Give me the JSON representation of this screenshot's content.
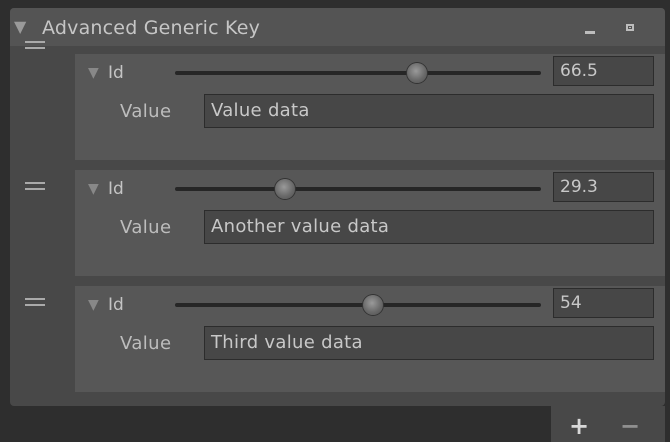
{
  "panel": {
    "title": "Advanced Generic Key",
    "collapse_icon": "triangle-down-icon",
    "minimize_icon": "minimize-icon",
    "maximize_icon": "maximize-icon"
  },
  "elements": [
    {
      "id_label": "Id",
      "id_value": "66.5",
      "slider_fraction": 0.66,
      "value_label": "Value",
      "value_text": "Value data"
    },
    {
      "id_label": "Id",
      "id_value": "29.3",
      "slider_fraction": 0.3,
      "value_label": "Value",
      "value_text": "Another value data"
    },
    {
      "id_label": "Id",
      "id_value": "54",
      "slider_fraction": 0.54,
      "value_label": "Value",
      "value_text": "Third value data"
    }
  ],
  "footer": {
    "add_label": "+",
    "remove_label": "−"
  },
  "colors": {
    "panel_bg": "#484848",
    "header_bg": "#545454",
    "element_bg": "#575757",
    "field_bg": "#474747",
    "text": "#c6c6c6"
  }
}
